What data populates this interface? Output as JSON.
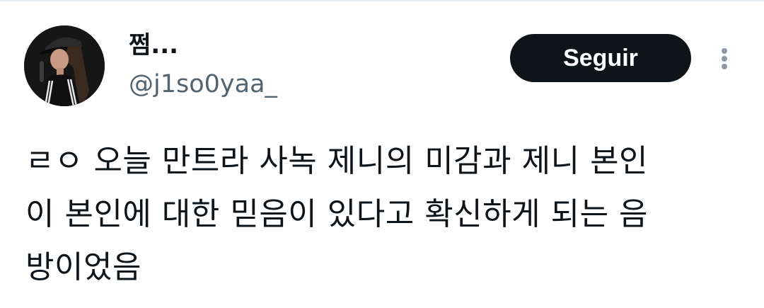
{
  "tweet": {
    "author": {
      "display_name": "쩜...",
      "handle": "@j1so0yaa_",
      "avatar_icon": "profile-photo"
    },
    "follow_label": "Seguir",
    "more_icon": "more-vertical-icon",
    "text_lines": [
      "ㄹㅇ 오늘 만트라 사녹 제니의 미감과 제니 본인",
      "이 본인에 대한 믿음이 있다고 확신하게 되는 음",
      "방이었음"
    ]
  },
  "colors": {
    "primary_text": "#0f1419",
    "secondary_text": "#536471",
    "button_bg": "#0f1419",
    "button_text": "#ffffff",
    "divider": "#e6ecf0"
  }
}
